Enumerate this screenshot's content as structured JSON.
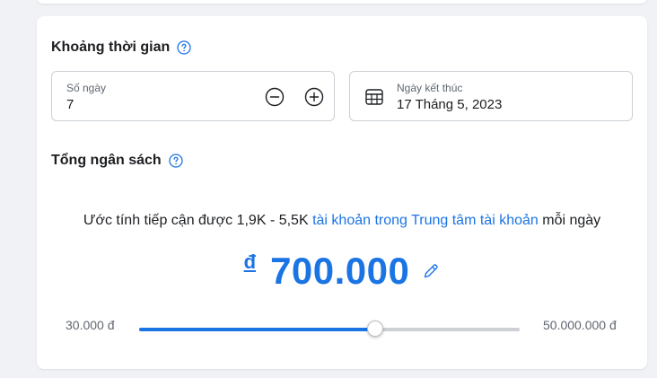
{
  "duration_section": {
    "title": "Khoảng thời gian",
    "help_icon": "question-circle-icon",
    "days_field": {
      "label": "Số ngày",
      "value": "7",
      "decrease_icon": "minus-circle-icon",
      "increase_icon": "plus-circle-icon"
    },
    "end_date_field": {
      "label": "Ngày kết thúc",
      "value": "17 Tháng 5, 2023",
      "icon": "calendar-icon"
    }
  },
  "budget_section": {
    "title": "Tổng ngân sách",
    "help_icon": "question-circle-icon",
    "reach_prefix": "Ước tính tiếp cận được 1,9K - 5,5K ",
    "reach_link": "tài khoản trong Trung tâm tài khoản",
    "reach_suffix": " mỗi ngày",
    "currency_symbol": "đ",
    "amount": "700.000",
    "edit_icon": "pencil-icon",
    "slider": {
      "min_label": "30.000 đ",
      "max_label": "50.000.000 đ",
      "level_fraction": 0.62
    }
  },
  "colors": {
    "accent": "#1b74e4",
    "text": "#1c1e21",
    "secondary_text": "#606770",
    "border": "#ccd0d5",
    "background": "#f0f2f5"
  }
}
